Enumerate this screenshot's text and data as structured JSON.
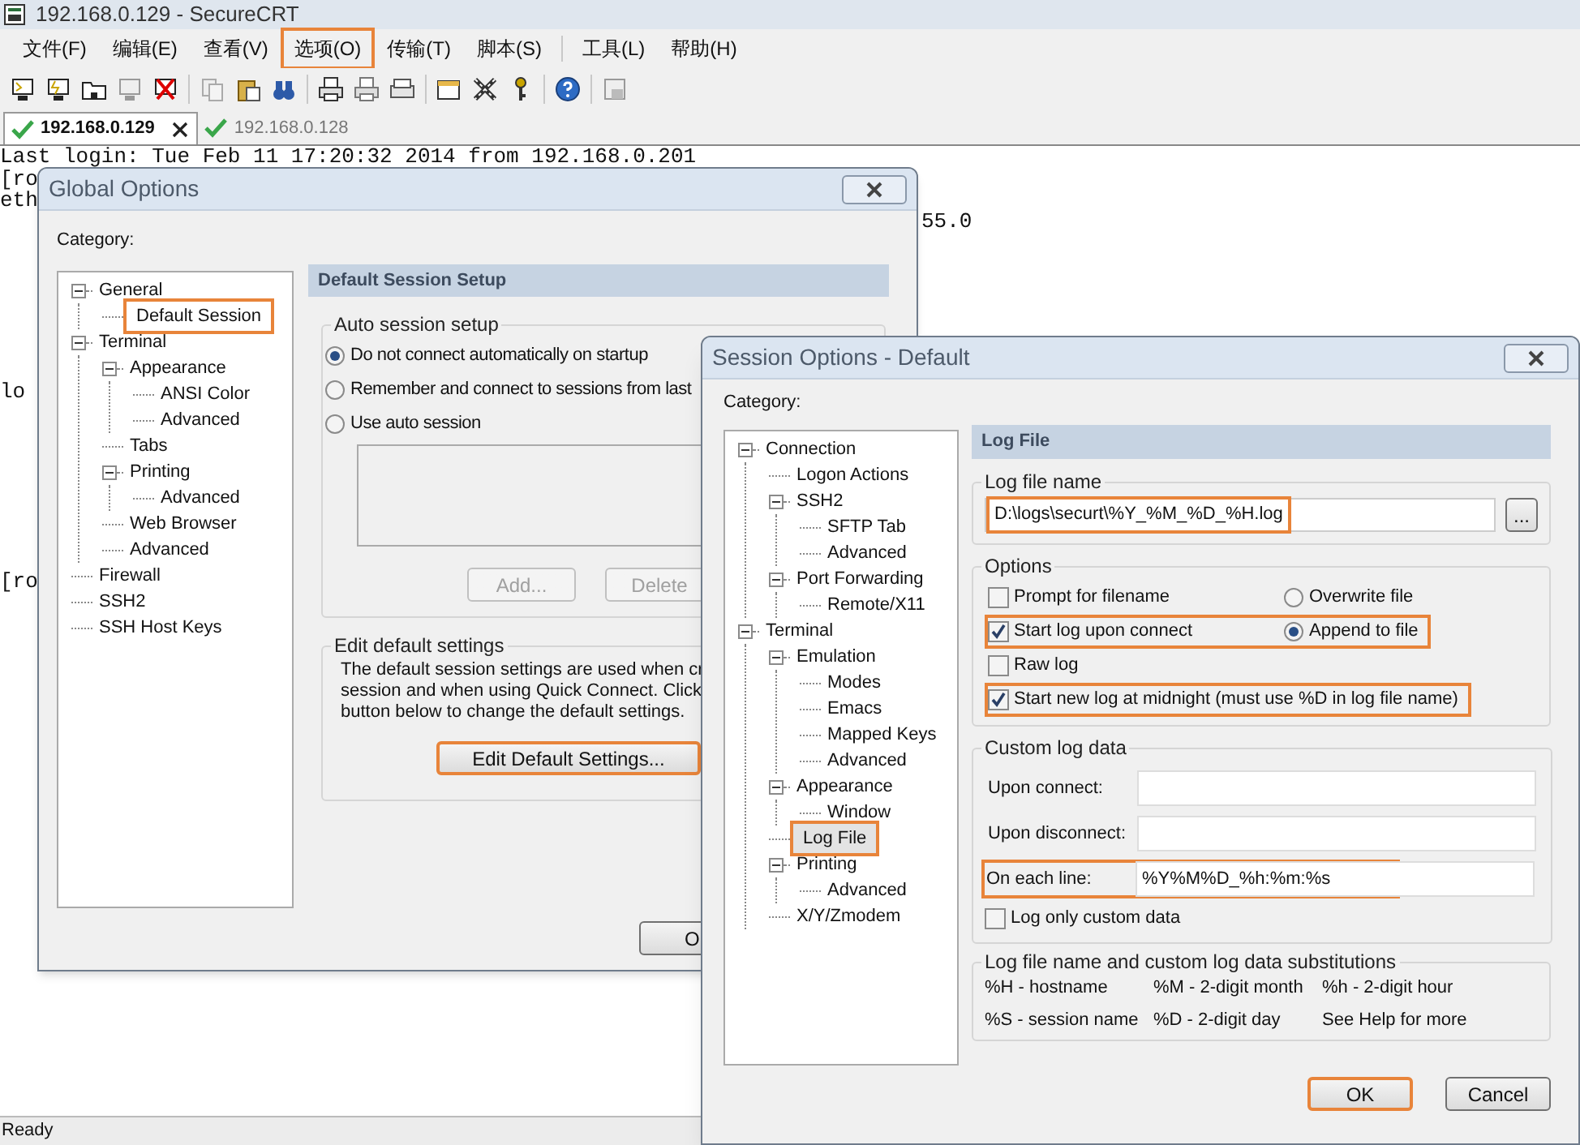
{
  "window": {
    "title": "192.168.0.129 - SecureCRT"
  },
  "menu": [
    {
      "label": "文件(F)",
      "highlighted": false
    },
    {
      "label": "编辑(E)",
      "highlighted": false
    },
    {
      "label": "查看(V)",
      "highlighted": false
    },
    {
      "label": "选项(O)",
      "highlighted": true
    },
    {
      "label": "传输(T)",
      "highlighted": false
    },
    {
      "label": "脚本(S)",
      "highlighted": false
    },
    {
      "label": "工具(L)",
      "highlighted": false
    },
    {
      "label": "帮助(H)",
      "highlighted": false
    }
  ],
  "tabs": [
    {
      "label": "192.168.0.129",
      "selected": true
    },
    {
      "label": "192.168.0.128",
      "selected": false
    }
  ],
  "terminal": {
    "lines": [
      "Last login: Tue Feb 11 17:20:32 2014 from 192.168.0.201",
      "[ro",
      "eth",
      "55.0",
      "lo",
      "[ro"
    ]
  },
  "global_options": {
    "title": "Global Options",
    "category_label": "Category:",
    "tree": [
      {
        "label": "General",
        "expanded": true,
        "selected": false,
        "highlighted": false,
        "children": [
          {
            "label": "Default Session",
            "selected": false,
            "highlighted": true
          }
        ]
      },
      {
        "label": "Terminal",
        "expanded": true,
        "selected": false,
        "highlighted": false,
        "children": [
          {
            "label": "Appearance",
            "expanded": true,
            "selected": false,
            "highlighted": false,
            "children": [
              {
                "label": "ANSI Color",
                "selected": false,
                "highlighted": false
              },
              {
                "label": "Advanced",
                "selected": false,
                "highlighted": false
              }
            ]
          },
          {
            "label": "Tabs",
            "selected": false,
            "highlighted": false
          },
          {
            "label": "Printing",
            "expanded": true,
            "selected": false,
            "highlighted": false,
            "children": [
              {
                "label": "Advanced",
                "selected": false,
                "highlighted": false
              }
            ]
          },
          {
            "label": "Web Browser",
            "selected": false,
            "highlighted": false
          },
          {
            "label": "Advanced",
            "selected": false,
            "highlighted": false
          }
        ]
      },
      {
        "label": "Firewall",
        "selected": false,
        "highlighted": false
      },
      {
        "label": "SSH2",
        "selected": false,
        "highlighted": false
      },
      {
        "label": "SSH Host Keys",
        "selected": false,
        "highlighted": false
      }
    ],
    "panel_title": "Default Session Setup",
    "auto_session": {
      "label": "Auto session setup",
      "options": [
        {
          "label": "Do not connect automatically on startup",
          "selected": true
        },
        {
          "label": "Remember and connect to sessions from last",
          "selected": false
        },
        {
          "label": "Use auto session",
          "selected": false
        }
      ],
      "buttons": [
        {
          "label": "Add...",
          "disabled": true
        },
        {
          "label": "Delete",
          "disabled": true
        }
      ]
    },
    "edit_defaults": {
      "label": "Edit default settings",
      "lines": [
        "The default session settings are used when cr",
        "session and when using Quick Connect.  Click",
        "button below to change the default settings."
      ],
      "button": {
        "label": "Edit Default Settings...",
        "highlighted": true
      }
    },
    "ok_button": "O"
  },
  "session_options": {
    "title": "Session Options - Default",
    "category_label": "Category:",
    "tree": [
      {
        "label": "Connection",
        "expanded": true,
        "selected": false,
        "highlighted": false,
        "children": [
          {
            "label": "Logon Actions",
            "selected": false,
            "highlighted": false
          },
          {
            "label": "SSH2",
            "expanded": true,
            "selected": false,
            "highlighted": false,
            "children": [
              {
                "label": "SFTP Tab",
                "selected": false,
                "highlighted": false
              },
              {
                "label": "Advanced",
                "selected": false,
                "highlighted": false
              }
            ]
          },
          {
            "label": "Port Forwarding",
            "expanded": true,
            "selected": false,
            "highlighted": false,
            "children": [
              {
                "label": "Remote/X11",
                "selected": false,
                "highlighted": false
              }
            ]
          }
        ]
      },
      {
        "label": "Terminal",
        "expanded": true,
        "selected": false,
        "highlighted": false,
        "children": [
          {
            "label": "Emulation",
            "expanded": true,
            "selected": false,
            "highlighted": false,
            "children": [
              {
                "label": "Modes",
                "selected": false,
                "highlighted": false
              },
              {
                "label": "Emacs",
                "selected": false,
                "highlighted": false
              },
              {
                "label": "Mapped Keys",
                "selected": false,
                "highlighted": false
              },
              {
                "label": "Advanced",
                "selected": false,
                "highlighted": false
              }
            ]
          },
          {
            "label": "Appearance",
            "expanded": true,
            "selected": false,
            "highlighted": false,
            "children": [
              {
                "label": "Window",
                "selected": false,
                "highlighted": false
              }
            ]
          },
          {
            "label": "Log File",
            "selected": true,
            "highlighted": true
          },
          {
            "label": "Printing",
            "expanded": true,
            "selected": false,
            "highlighted": false,
            "children": [
              {
                "label": "Advanced",
                "selected": false,
                "highlighted": false
              }
            ]
          },
          {
            "label": "X/Y/Zmodem",
            "selected": false,
            "highlighted": false
          }
        ]
      }
    ],
    "panel_title": "Log File",
    "log_file_name": {
      "label": "Log file name",
      "value": "D:\\logs\\securt\\%Y_%M_%D_%H.log",
      "browse": "...",
      "highlighted": true
    },
    "options": {
      "label": "Options",
      "rows": [
        {
          "checkbox": {
            "label": "Prompt for filename",
            "checked": false
          },
          "radio": {
            "label": "Overwrite file",
            "selected": false
          },
          "highlighted": false
        },
        {
          "checkbox": {
            "label": "Start log upon connect",
            "checked": true
          },
          "radio": {
            "label": "Append to file",
            "selected": true
          },
          "highlighted": true
        },
        {
          "checkbox": {
            "label": "Raw log",
            "checked": false
          },
          "highlighted": false
        },
        {
          "checkbox": {
            "label": "Start new log at midnight (must use %D in log file name)",
            "checked": true
          },
          "highlighted": true
        }
      ]
    },
    "custom_log_data": {
      "label": "Custom log data",
      "fields": [
        {
          "label": "Upon connect:",
          "highlighted": false
        },
        {
          "label": "Upon disconnect:",
          "highlighted": false
        },
        {
          "label": "On each line:",
          "value": "%Y%M%D_%h:%m:%s",
          "highlighted": true
        }
      ],
      "log_only": {
        "label": "Log only custom data",
        "checked": false
      }
    },
    "substitutions": {
      "label": "Log file name and custom log data substitutions",
      "items": [
        "%H - hostname",
        "%M - 2-digit month",
        "%h - 2-digit hour",
        "%S - session name",
        "%D - 2-digit day",
        "See Help for more"
      ]
    },
    "buttons": [
      {
        "label": "OK",
        "highlighted": true
      },
      {
        "label": "Cancel",
        "highlighted": false
      }
    ]
  },
  "status_bar": "Ready"
}
